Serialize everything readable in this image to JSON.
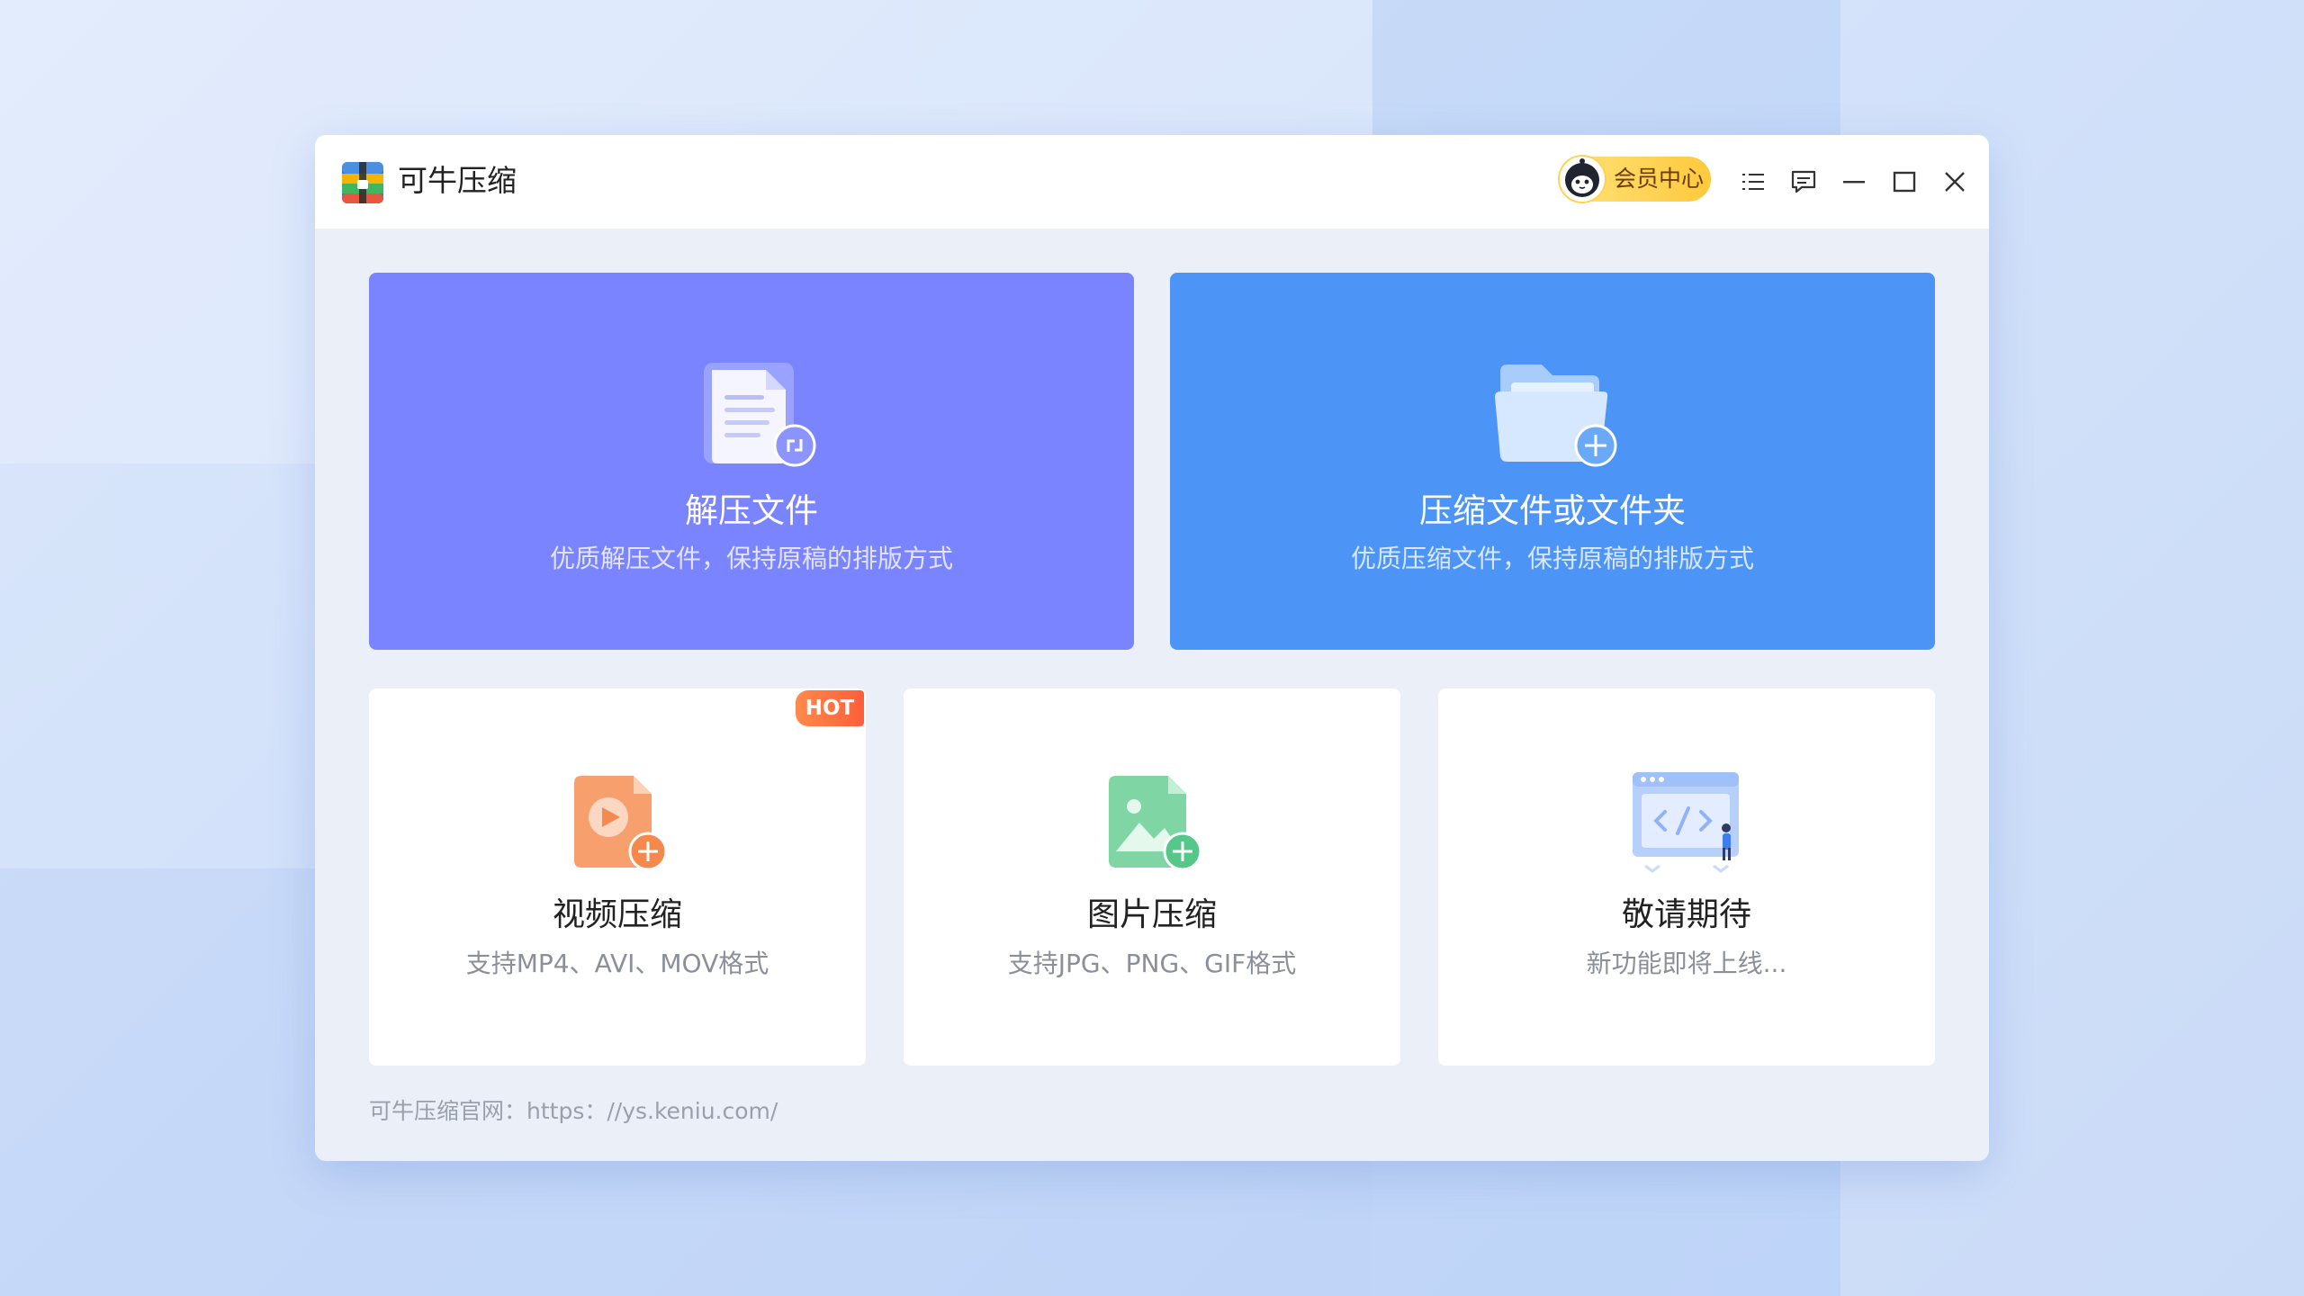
{
  "app": {
    "title": "可牛压缩",
    "vip_label": "会员中心"
  },
  "window_controls": {
    "menu_icon": "list-menu-icon",
    "feedback_icon": "message-icon",
    "minimize_icon": "minimize-icon",
    "maximize_icon": "maximize-icon",
    "close_icon": "close-icon"
  },
  "cards": {
    "extract": {
      "title": "解压文件",
      "subtitle": "优质解压文件，保持原稿的排版方式",
      "color": "#7b84ff"
    },
    "compress": {
      "title": "压缩文件或文件夹",
      "subtitle": "优质压缩文件，保持原稿的排版方式",
      "color": "#4d94f7"
    },
    "video": {
      "title": "视频压缩",
      "subtitle": "支持MP4、AVI、MOV格式",
      "badge": "HOT"
    },
    "image": {
      "title": "图片压缩",
      "subtitle": "支持JPG、PNG、GIF格式"
    },
    "soon": {
      "title": "敬请期待",
      "subtitle": "新功能即将上线..."
    }
  },
  "footer": {
    "text": "可牛压缩官网：https：//ys.keniu.com/"
  }
}
